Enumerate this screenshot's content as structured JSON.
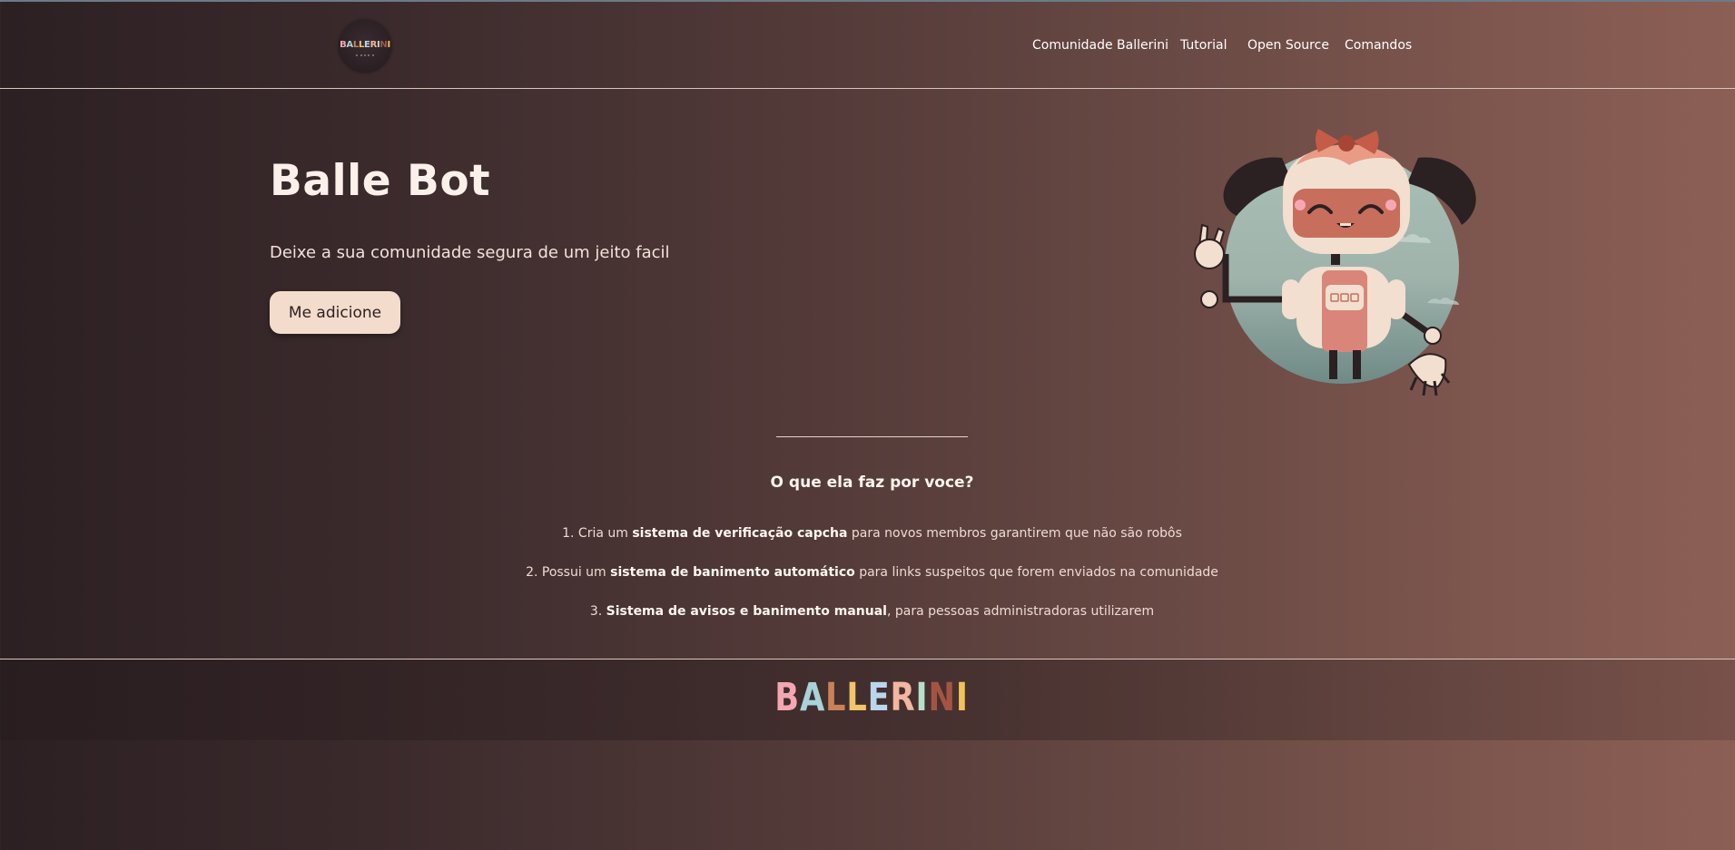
{
  "header": {
    "logo_text": "BALLERINI",
    "nav": [
      "Comunidade Ballerini",
      "Tutorial",
      "Open Source",
      "Comandos"
    ]
  },
  "hero": {
    "title": "Balle Bot",
    "subtitle": "Deixe a sua comunidade segura de um jeito facil",
    "button_label": "Me adicione",
    "illustration_icon": "robot-girl-illustration"
  },
  "features": {
    "title": "O que ela faz por voce?",
    "items": [
      {
        "number": "1.",
        "before": "Cria um ",
        "bold": "sistema de verificação capcha",
        "after": " para novos membros garantirem que não são robôs"
      },
      {
        "number": "2.",
        "before": "Possui um ",
        "bold": "sistema de banimento automático",
        "after": " para links suspeitos que forem enviados na comunidade"
      },
      {
        "number": "3.",
        "before": "",
        "bold": "Sistema de avisos e banimento manual",
        "after": ", para pessoas administradoras utilizarem"
      }
    ]
  },
  "footer": {
    "logo_letters": [
      "B",
      "A",
      "L",
      "L",
      "E",
      "R",
      "I",
      "N",
      "I"
    ],
    "logo_colors": [
      "#f4a6b2",
      "#a8d3d8",
      "#c98257",
      "#f2c46b",
      "#b9d7ef",
      "#f3b6a1",
      "#b8dfc9",
      "#a55444",
      "#f1c25c"
    ]
  },
  "colors": {
    "background_start": "#2c2023",
    "background_end": "#8c5f55",
    "button_bg": "#f3dccb",
    "text_light": "#f6e9e2"
  }
}
